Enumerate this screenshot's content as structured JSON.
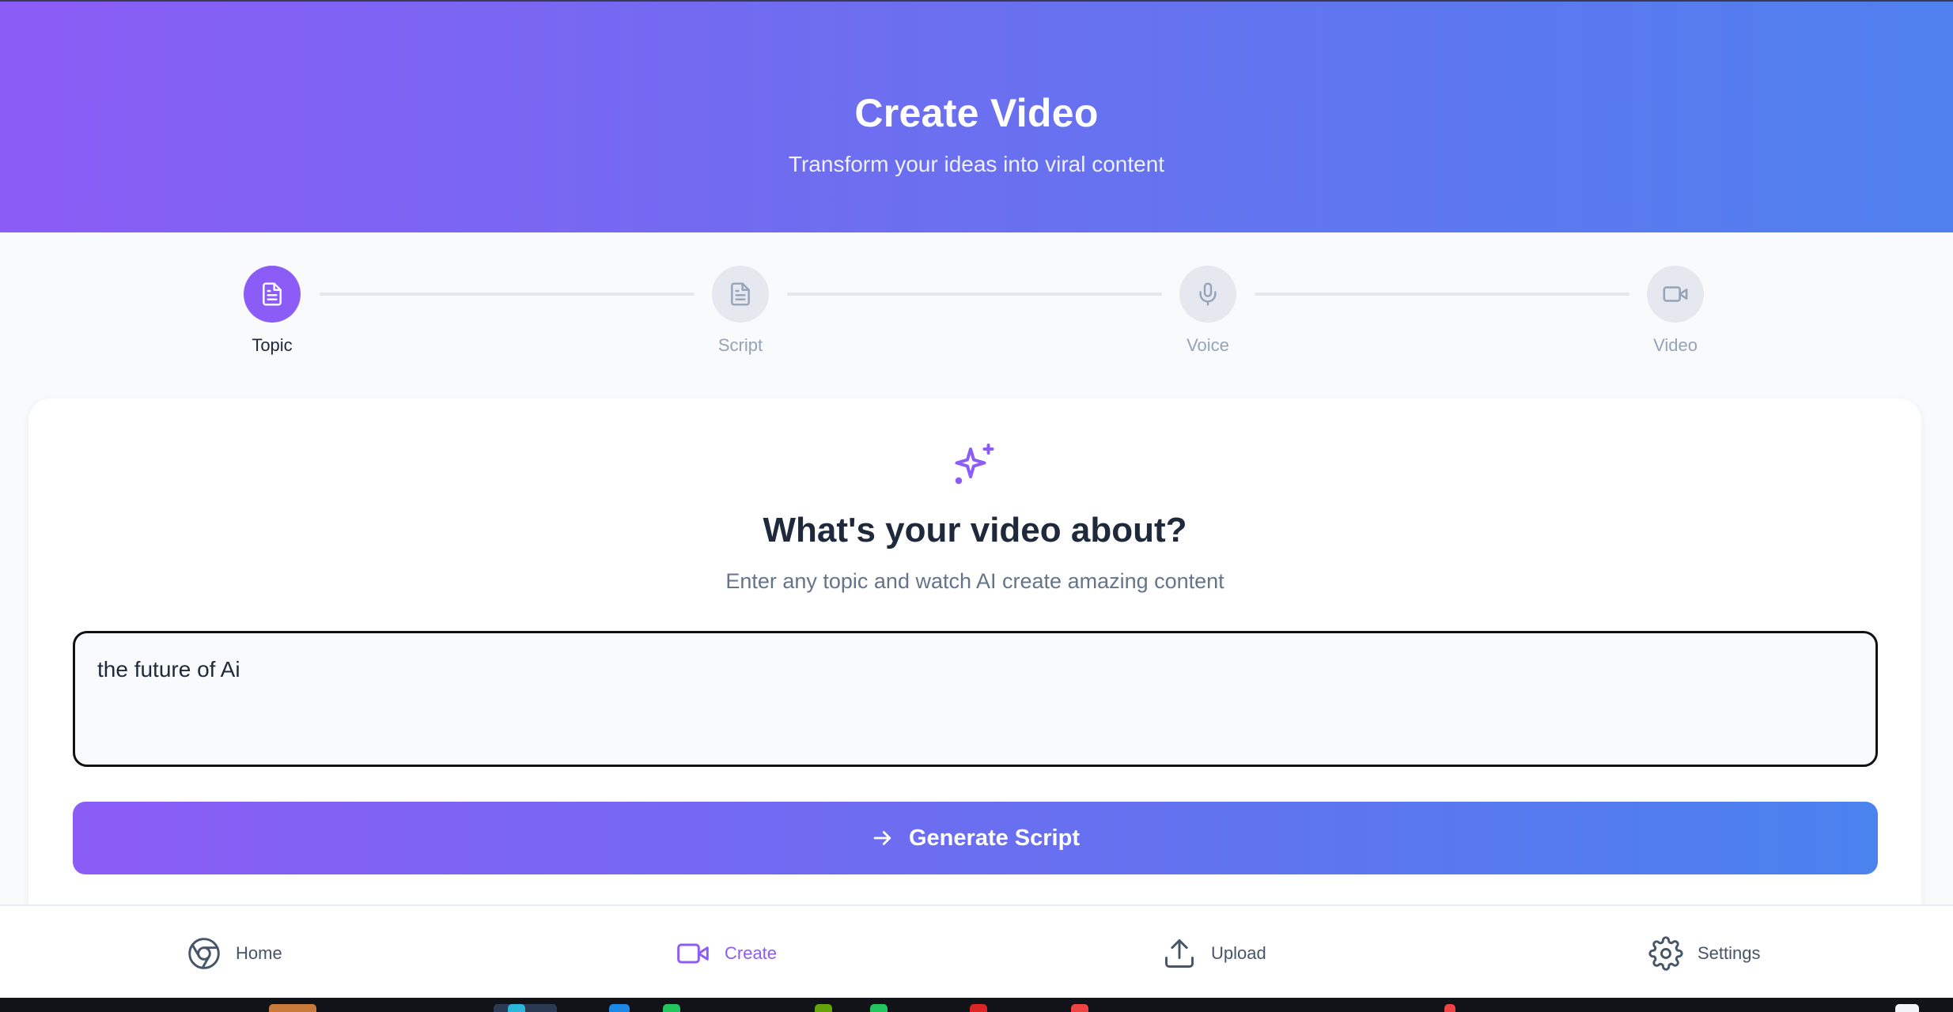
{
  "header": {
    "title": "Create Video",
    "subtitle": "Transform your ideas into viral content"
  },
  "stepper": {
    "steps": [
      {
        "label": "Topic",
        "icon": "document-icon",
        "active": true
      },
      {
        "label": "Script",
        "icon": "document-icon",
        "active": false
      },
      {
        "label": "Voice",
        "icon": "microphone-icon",
        "active": false
      },
      {
        "label": "Video",
        "icon": "video-camera-icon",
        "active": false
      }
    ]
  },
  "card": {
    "icon": "sparkles-icon",
    "title": "What's your video about?",
    "subtitle": "Enter any topic and watch AI create amazing content",
    "topic_value": "the future of Ai",
    "generate_label": "Generate Script"
  },
  "bottom_nav": {
    "items": [
      {
        "label": "Home",
        "icon": "chrome-icon",
        "active": false
      },
      {
        "label": "Create",
        "icon": "video-camera-icon",
        "active": true
      },
      {
        "label": "Upload",
        "icon": "upload-icon",
        "active": false
      },
      {
        "label": "Settings",
        "icon": "gear-icon",
        "active": false
      }
    ]
  },
  "colors": {
    "accent": "#8b5cf6",
    "gradient_start": "#8b5cf6",
    "gradient_end": "#4a82ee",
    "muted": "#94a3b8"
  }
}
